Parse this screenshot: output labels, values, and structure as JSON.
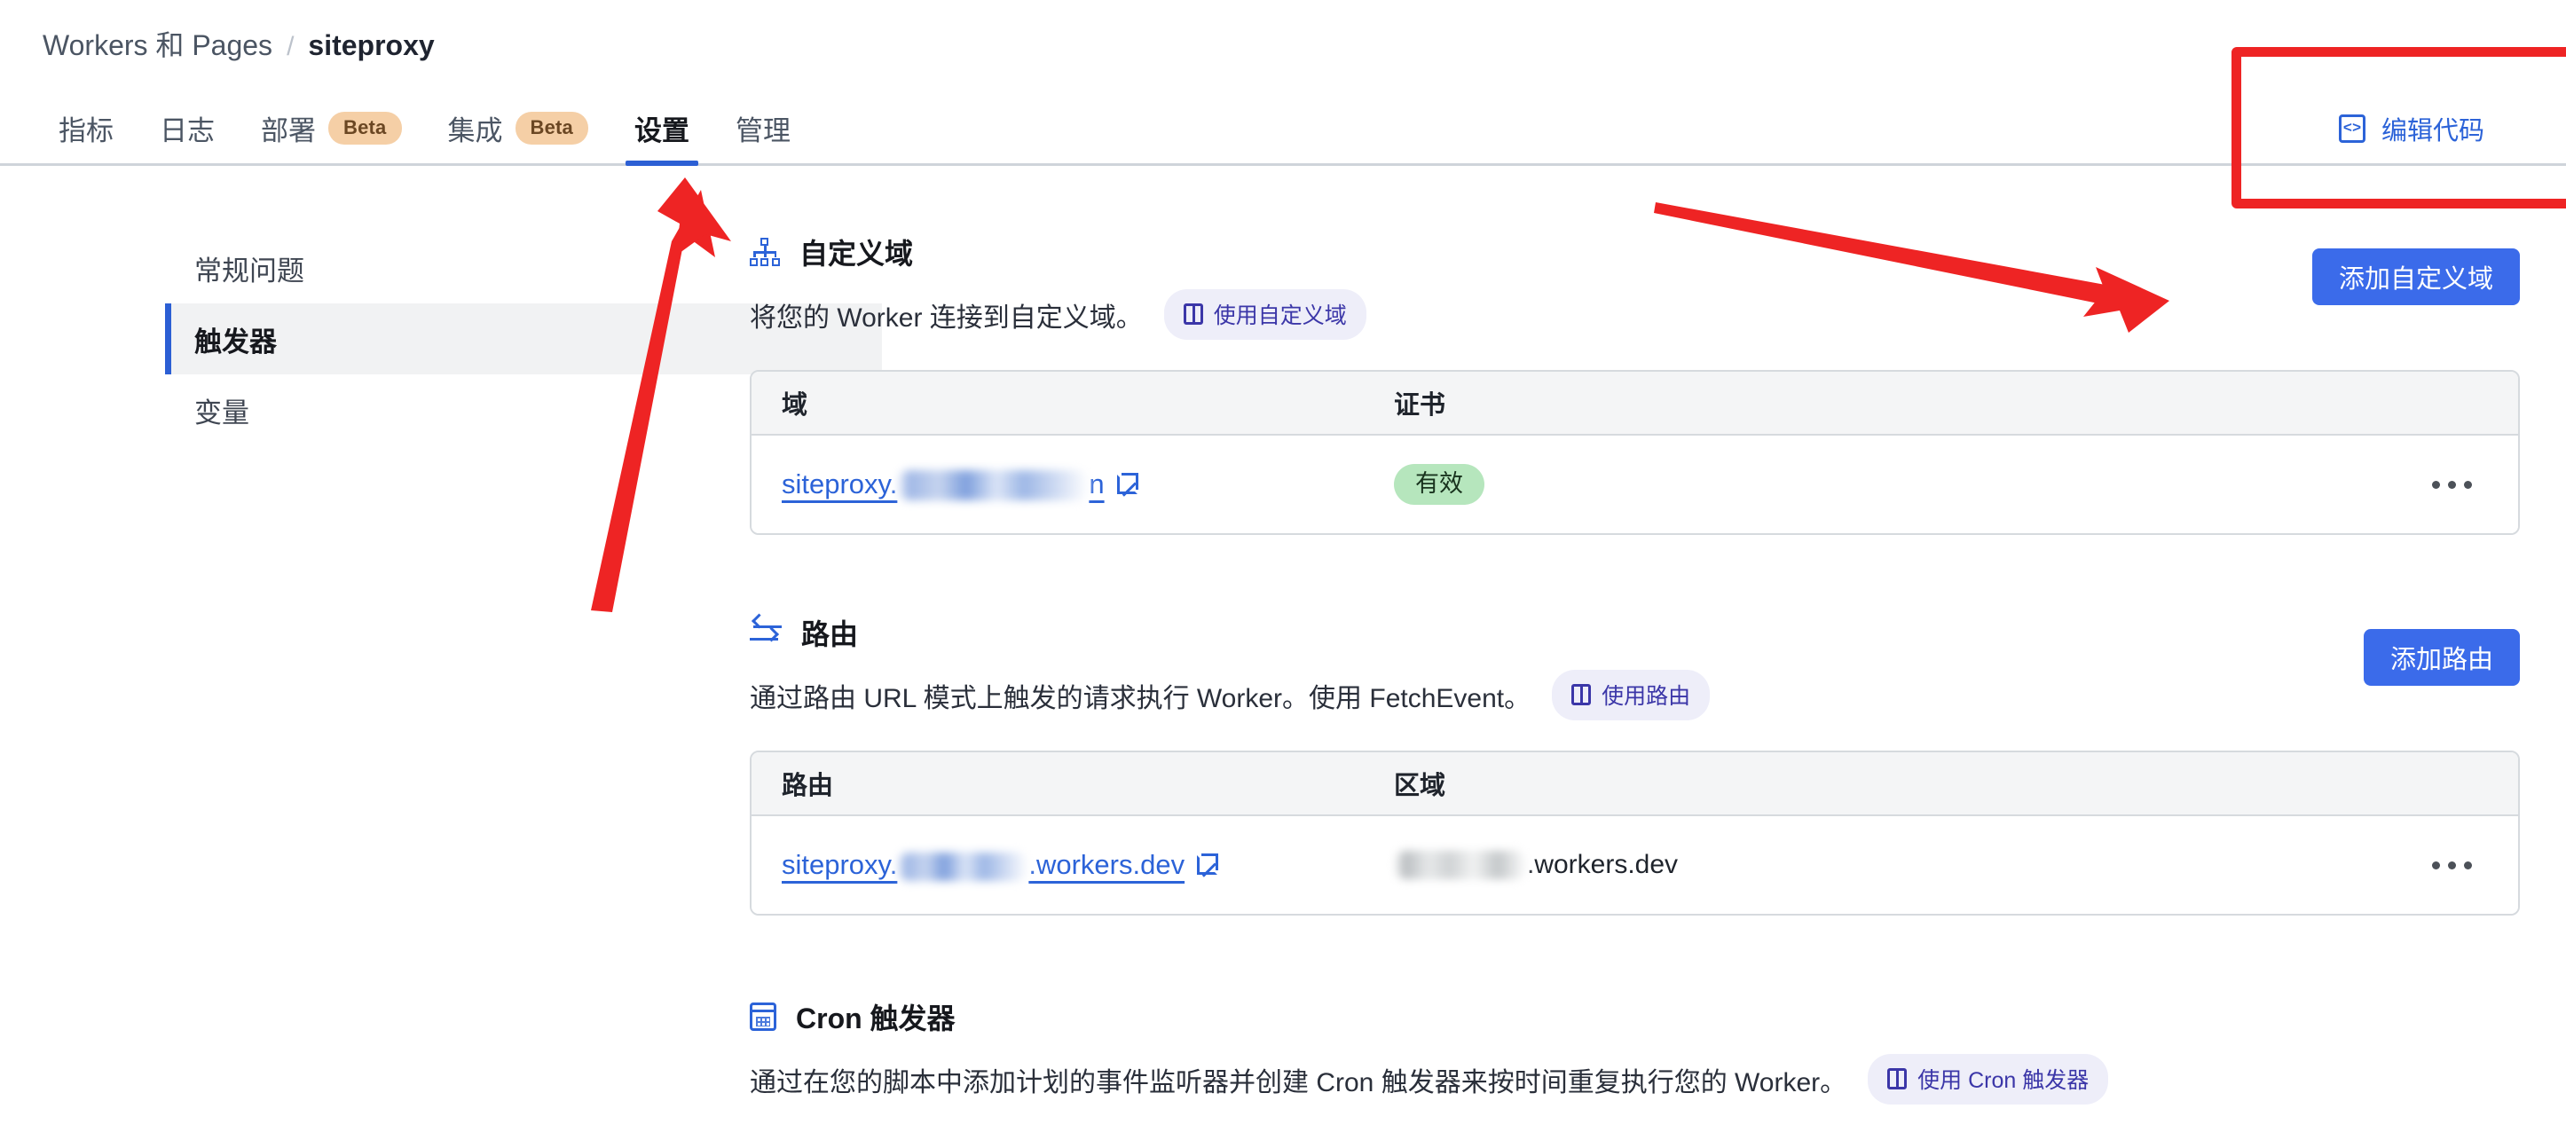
{
  "breadcrumb": {
    "parent": "Workers 和 Pages",
    "separator": "/",
    "current": "siteproxy"
  },
  "tabs": [
    {
      "label": "指标",
      "badge": null,
      "active": false
    },
    {
      "label": "日志",
      "badge": null,
      "active": false
    },
    {
      "label": "部署",
      "badge": "Beta",
      "active": false
    },
    {
      "label": "集成",
      "badge": "Beta",
      "active": false
    },
    {
      "label": "设置",
      "badge": null,
      "active": true
    },
    {
      "label": "管理",
      "badge": null,
      "active": false
    }
  ],
  "header_actions": {
    "edit_code_label": "编辑代码",
    "edit_code_icon": "code-brackets-icon"
  },
  "subnav": [
    {
      "label": "常规问题",
      "active": false
    },
    {
      "label": "触发器",
      "active": true
    },
    {
      "label": "变量",
      "active": false
    }
  ],
  "sections": {
    "custom_domains": {
      "icon": "sitemap-icon",
      "title": "自定义域",
      "description": "将您的 Worker 连接到自定义域。",
      "doc_badge": "使用自定义域",
      "action_button": "添加自定义域",
      "table": {
        "columns": [
          "域",
          "证书"
        ],
        "rows": [
          {
            "domain_prefix": "siteproxy.",
            "domain_redacted": true,
            "domain_suffix": "n",
            "external_link": true,
            "certificate_status": "有效",
            "overflow_menu": "..."
          }
        ]
      }
    },
    "routes": {
      "icon": "swap-arrows-icon",
      "title": "路由",
      "description": "通过路由 URL 模式上触发的请求执行 Worker。使用 FetchEvent。",
      "doc_badge": "使用路由",
      "action_button": "添加路由",
      "table": {
        "columns": [
          "路由",
          "区域"
        ],
        "rows": [
          {
            "route_prefix": "siteproxy.",
            "route_redacted": true,
            "route_suffix": ".workers.dev",
            "external_link": true,
            "zone_redacted": true,
            "zone_suffix": ".workers.dev",
            "overflow_menu": "..."
          }
        ]
      }
    },
    "cron_triggers": {
      "icon": "calendar-icon",
      "title": "Cron 触发器",
      "description": "通过在您的脚本中添加计划的事件监听器并创建 Cron 触发器来按时间重复执行您的 Worker。",
      "doc_badge": "使用 Cron 触发器"
    }
  },
  "annotations": {
    "highlight_color": "#ee2424",
    "rectangle_target": "编辑代码",
    "arrow_up_target": "设置",
    "arrow_right_target": "添加自定义域"
  },
  "colors": {
    "accent_blue": "#3b6bea",
    "link_blue": "#2c63d8",
    "active_tab_underline": "#2c5fd4",
    "beta_badge_bg": "#f5cfa6",
    "doc_badge_bg": "#eeeef9",
    "doc_badge_text": "#3b36a8",
    "status_valid_bg": "#b6e6bd",
    "annotation_red": "#ee2424"
  }
}
